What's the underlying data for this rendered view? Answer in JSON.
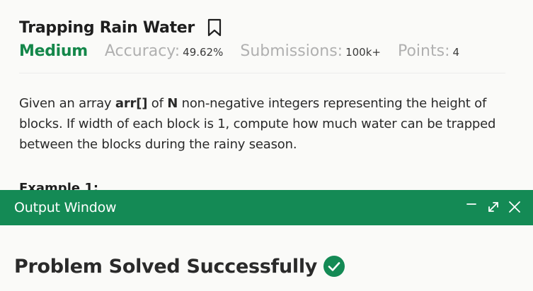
{
  "problem": {
    "title": "Trapping Rain Water",
    "difficulty": "Medium",
    "accuracy_label": "Accuracy:",
    "accuracy_value": "49.62%",
    "submissions_label": "Submissions:",
    "submissions_value": "100k+",
    "points_label": "Points:",
    "points_value": "4",
    "description": {
      "p1": "Given an array ",
      "arr": "arr[]",
      "p2": " of ",
      "n": "N",
      "p3": " non-negative integers representing the height of blocks. If width of each block is 1, compute how much water can be trapped between the blocks during the rainy season."
    },
    "example_heading": "Example 1:"
  },
  "output_window": {
    "title": "Output Window",
    "result_text": "Problem Solved Successfully"
  },
  "icons": {
    "bookmark": "bookmark-icon",
    "minimize": "minimize-icon",
    "expand": "expand-icon",
    "close": "close-icon",
    "success": "check-circle-icon"
  },
  "colors": {
    "brand_green": "#148a55",
    "difficulty_green": "#14874a",
    "label_gray": "#b0b0b0"
  }
}
